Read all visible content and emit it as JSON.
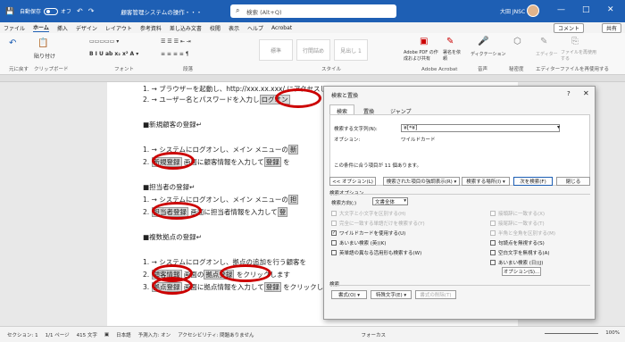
{
  "titlebar": {
    "autosave_label": "自動保存",
    "autosave_state": "オフ",
    "doc_title": "顧客管理システムの操作・・・",
    "search_placeholder": "検索 (Alt+Q)",
    "user_name": "大田 JNSC",
    "minimize": "—",
    "maximize": "□",
    "close": "✕"
  },
  "menu": {
    "tabs": [
      "ファイル",
      "ホーム",
      "挿入",
      "デザイン",
      "レイアウト",
      "参考資料",
      "差し込み文書",
      "校閲",
      "表示",
      "ヘルプ",
      "Acrobat"
    ],
    "comment_label": "コメント",
    "share_label": "共有"
  },
  "ribbon": {
    "groups": [
      "元に戻す",
      "クリップボード",
      "フォント",
      "段落",
      "スタイル",
      "Adobe Acrobat",
      "音声",
      "秘密度",
      "エディター",
      "ファイルを再使用する"
    ],
    "paste_label": "貼り付け",
    "styles": [
      "標準",
      "行間詰め",
      "見出し 1"
    ],
    "acrobat_buttons": [
      "Adobe PDF の作成および共有",
      "署名を依頼"
    ],
    "dictation_label": "ディクテーション",
    "sensitivity_label": "秘密度",
    "editor_label": "エディター",
    "reuse_label": "ファイルを再使用する"
  },
  "document": {
    "lines": [
      {
        "text": "1. → ブラウザーを起動し、http://xxx.xx.xxx/ にアクセスします。↵"
      },
      {
        "pre": "2. → ユーザー名とパスワードを入力し",
        "hl": "ログオン",
        "post": ""
      },
      {
        "text": "■新規顧客の登録↵"
      },
      {
        "pre": "1. → システムにログオンし、メイン メニューの",
        "hl": "新",
        "post": ""
      },
      {
        "pre": "2. ",
        "hl": "新規登録",
        "post": " 画面に顧客情報を入力して",
        "hl2": "登録",
        "post2": " を"
      },
      {
        "text": "■担当者の登録↵"
      },
      {
        "pre": "1. → システムにログオンし、メイン メニューの",
        "hl": "担",
        "post": ""
      },
      {
        "pre": "2. ",
        "hl": "担当者登録",
        "post": " 画面に担当者情報を入力して",
        "hl2": "登",
        "post2": ""
      },
      {
        "text": "■複数拠点の登録↵"
      },
      {
        "pre": "1. → システムにログオンし、拠点の追加を行う顧客を",
        "hl": "",
        "post": ""
      },
      {
        "pre": "2. ",
        "hl": "顧客情報",
        "post": " 画面の",
        "hl2": "拠点登録",
        "post2": " をクリックします"
      },
      {
        "pre": "3. ",
        "hl": "拠点登録",
        "post": " 画面に拠点情報を入力して",
        "hl2": "登録",
        "post2": " をクリックします。↵"
      }
    ]
  },
  "dialog": {
    "title": "検索と置換",
    "help": "?",
    "close": "✕",
    "tabs": [
      "検索",
      "置換",
      "ジャンプ"
    ],
    "find_label": "検索する文字列(N):",
    "find_value": "¥[*¥]",
    "options_label": "オプション:",
    "options_value": "ワイルドカード",
    "result_text": "この条件に合う項目が 11 個あります。",
    "btn_less": "<< オプション(L)",
    "btn_highlight": "検索された項目の強調表示(R) ▾",
    "btn_find_in": "検索する場所(I) ▾",
    "btn_next": "次を検索(F)",
    "btn_close": "閉じる",
    "search_options_label": "検索オプション",
    "direction_label": "検索方向(;)",
    "direction_value": "文書全体",
    "checks_left": [
      {
        "label": "大文字と小文字を区別する(H)",
        "checked": false,
        "disabled": true
      },
      {
        "label": "完全に一致する単語だけを検索する(Y)",
        "checked": false,
        "disabled": true
      },
      {
        "label": "ワイルドカードを使用する(U)",
        "checked": true,
        "disabled": false
      },
      {
        "label": "あいまい検索 (英)(K)",
        "checked": false,
        "disabled": false
      },
      {
        "label": "英単語の異なる活用形も検索する(W)",
        "checked": false,
        "disabled": false
      }
    ],
    "checks_right": [
      {
        "label": "接頭辞に一致する(X)",
        "checked": false,
        "disabled": true
      },
      {
        "label": "接尾辞に一致する(T)",
        "checked": false,
        "disabled": true
      },
      {
        "label": "半角と全角を区別する(M)",
        "checked": false,
        "disabled": true
      },
      {
        "label": "句読点を無視する(S)",
        "checked": false,
        "disabled": false
      },
      {
        "label": "空白文字を無視する(A)",
        "checked": false,
        "disabled": false
      },
      {
        "label": "あいまい検索 (日)(J)",
        "checked": false,
        "disabled": false
      }
    ],
    "options_btn": "オプション(S)...",
    "search_section_label": "検索",
    "btn_format": "書式(O) ▾",
    "btn_special": "特殊文字(E) ▾",
    "btn_clear_format": "書式の削除(T)"
  },
  "status": {
    "section": "セクション: 1",
    "page": "1/1 ページ",
    "words": "415 文字",
    "language": "日本語",
    "input": "予測入力: オン",
    "accessibility": "アクセシビリティ: 問題ありません",
    "focus": "フォーカス",
    "zoom": "100%"
  },
  "colors": {
    "accent": "#1e5fb4",
    "oval": "#c00000"
  }
}
